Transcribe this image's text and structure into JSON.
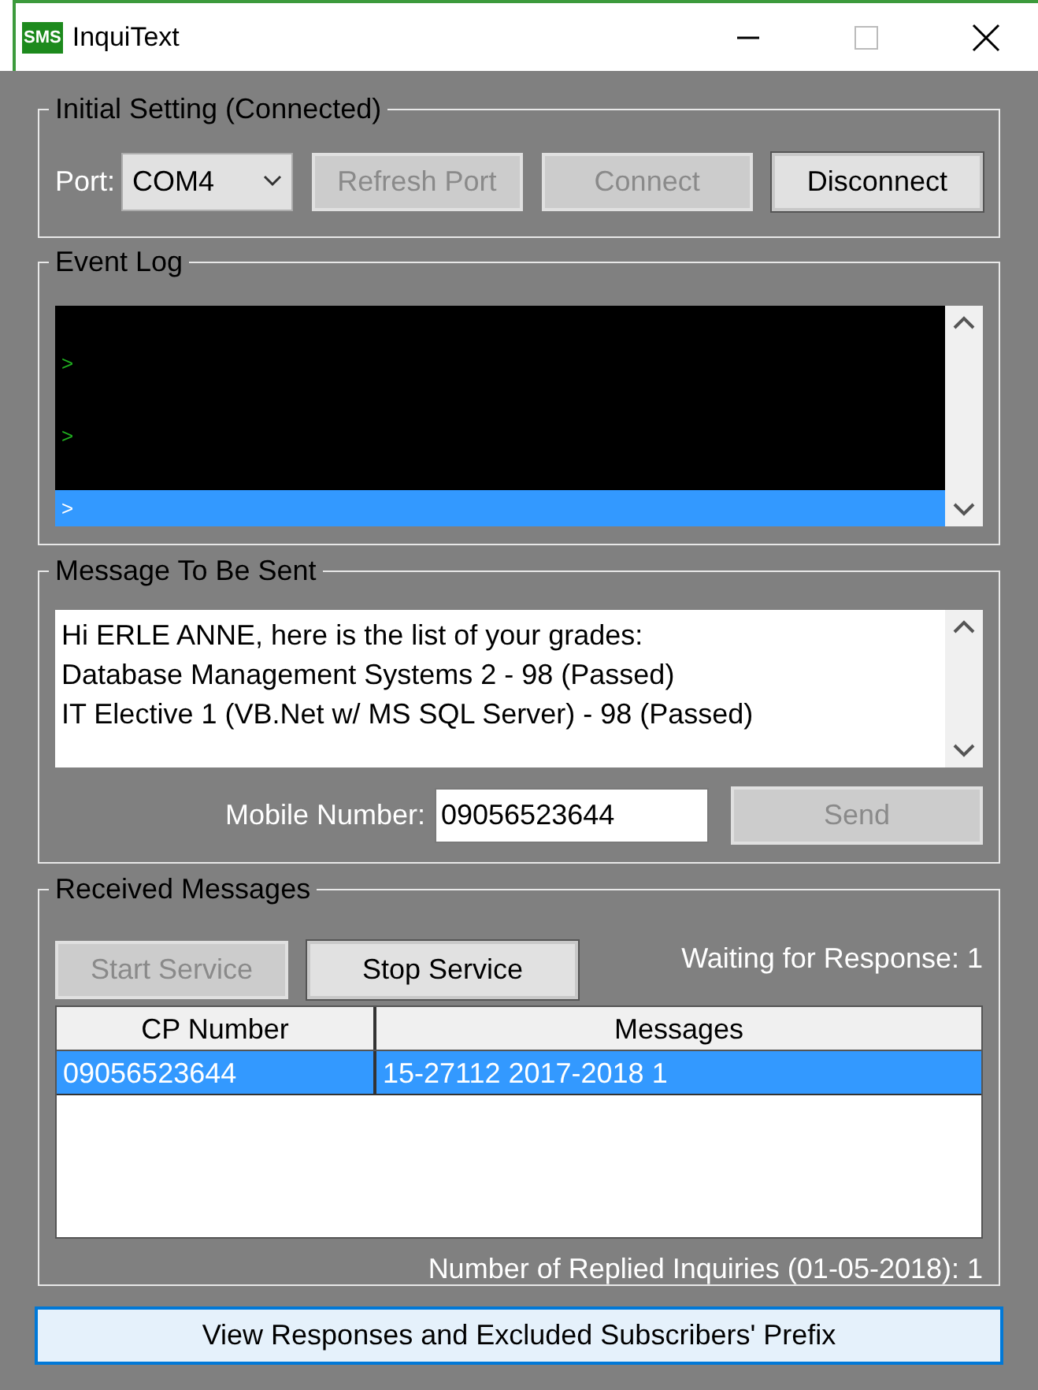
{
  "window": {
    "title": "InquiText",
    "app_icon": "SMS"
  },
  "initial_setting": {
    "title": "Initial Setting (Connected)",
    "port_label": "Port:",
    "port_value": "COM4",
    "buttons": [
      {
        "label": "Refresh Port",
        "disabled": true
      },
      {
        "label": "Connect",
        "disabled": true
      },
      {
        "label": "Disconnect",
        "disabled": false
      }
    ]
  },
  "event_log": {
    "title": "Event Log",
    "lines": [
      {
        "text": ">",
        "selected": false
      },
      {
        "text": ">",
        "selected": false
      },
      {
        "text": ">",
        "selected": true
      }
    ]
  },
  "message": {
    "title": "Message To Be Sent",
    "lines": [
      "Hi ERLE ANNE, here is the list of your grades:",
      "Database Management Systems 2 - 98 (Passed)",
      "IT Elective 1 (VB.Net w/ MS SQL Server) - 98 (Passed)"
    ],
    "mobile_label": "Mobile Number:",
    "mobile_value": "09056523644",
    "send": {
      "label": "Send",
      "disabled": true
    }
  },
  "received": {
    "title": "Received Messages",
    "buttons": [
      {
        "label": "Start Service",
        "disabled": true
      },
      {
        "label": "Stop Service",
        "disabled": false
      }
    ],
    "waiting": "Waiting for Response: 1",
    "table": {
      "columns": [
        "CP Number",
        "Messages"
      ],
      "rows": [
        {
          "cells": [
            "09056523644",
            "15-27112 2017-2018 1"
          ],
          "selected": true
        }
      ]
    },
    "replied": "Number of Replied Inquiries (01-05-2018): 1"
  },
  "bottom_button": "View Responses and Excluded Subscribers' Prefix"
}
